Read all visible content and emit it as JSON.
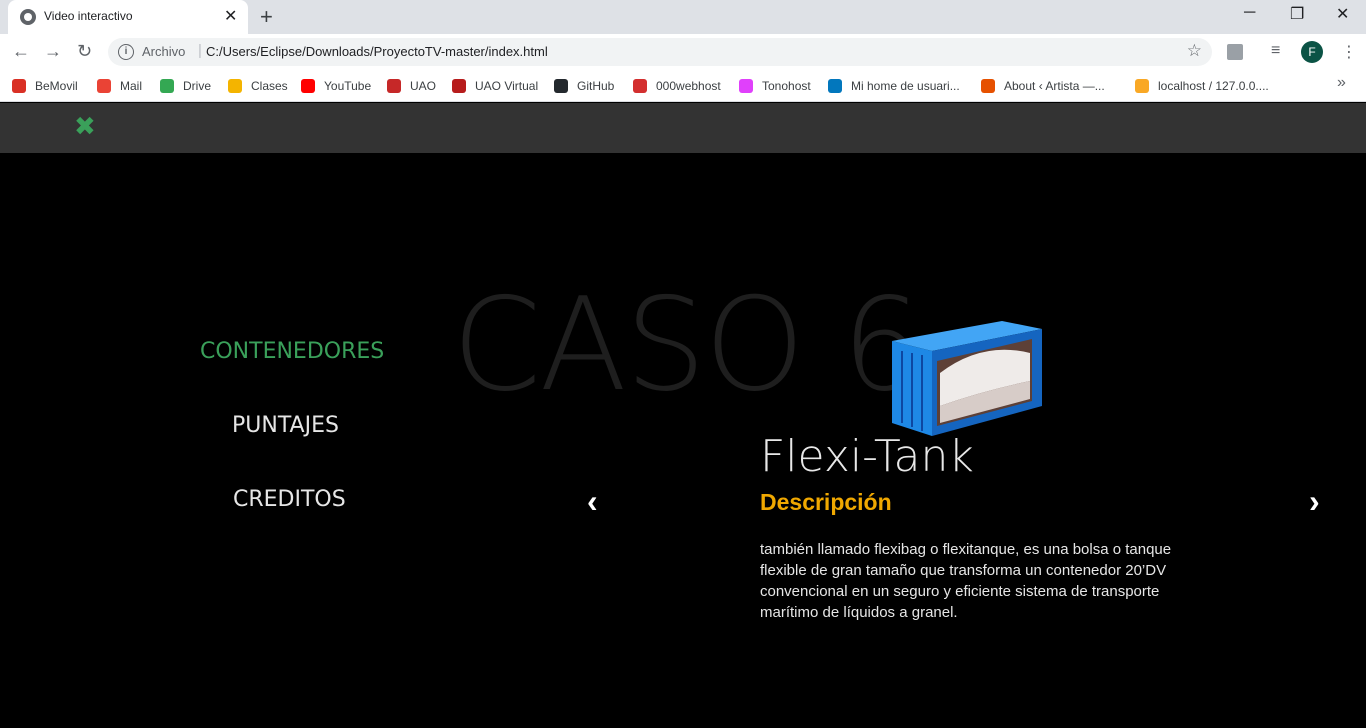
{
  "browser": {
    "tab_title": "Video interactivo",
    "url_scheme": "Archivo",
    "url": "C:/Users/Eclipse/Downloads/ProyectoTV-master/index.html",
    "profile_initial": "F",
    "bookmarks": [
      {
        "label": "BeMovil",
        "color": "#d93025"
      },
      {
        "label": "Mail",
        "color": "#ea4335"
      },
      {
        "label": "Drive",
        "color": "#34a853"
      },
      {
        "label": "Clases",
        "color": "#f4b400"
      },
      {
        "label": "YouTube",
        "color": "#ff0000"
      },
      {
        "label": "UAO",
        "color": "#c62828"
      },
      {
        "label": "UAO Virtual",
        "color": "#b71c1c"
      },
      {
        "label": "GitHub",
        "color": "#24292e"
      },
      {
        "label": "000webhost",
        "color": "#d32f2f"
      },
      {
        "label": "Tonohost",
        "color": "#e040fb"
      },
      {
        "label": "Mi home de usuari...",
        "color": "#0277bd"
      },
      {
        "label": "About ‹ Artista —...",
        "color": "#e65100"
      },
      {
        "label": "localhost / 127.0.0....",
        "color": "#f9a825"
      }
    ]
  },
  "page": {
    "menu": [
      {
        "label": "CONTENEDORES",
        "active": true
      },
      {
        "label": "PUNTAJES",
        "active": false
      },
      {
        "label": "CREDITOS",
        "active": false
      }
    ],
    "case_title": "CASO 6",
    "product_name": "Flexi-Tank",
    "section_label": "Descripción",
    "description": "también llamado flexibag o flexitanque, es una bolsa o tanque flexible de gran tamaño que transforma un contenedor 20’DV convencional en un seguro y eficiente sistema de transporte marítimo de líquidos a granel.",
    "prev_arrow": "‹",
    "next_arrow": "›",
    "close_symbol": "✖"
  },
  "colors": {
    "accent_green": "#3aa05a",
    "accent_orange": "#f0a800",
    "container_blue": "#1e88e5"
  }
}
